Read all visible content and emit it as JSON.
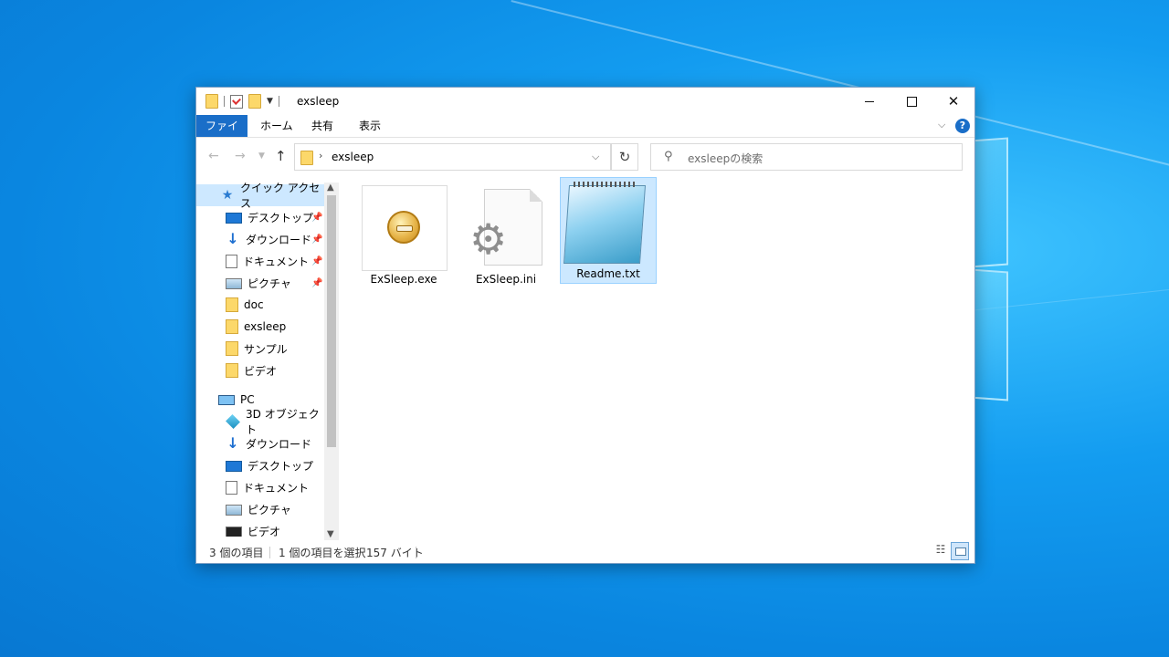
{
  "window": {
    "title": "exsleep"
  },
  "ribbon": {
    "tabs": [
      "ファイル",
      "ホーム",
      "共有",
      "表示"
    ]
  },
  "address": {
    "path": "exsleep",
    "search_placeholder": "exsleepの検索"
  },
  "nav_pane": {
    "quick_access": "クイック アクセス",
    "quick_items": [
      {
        "label": "デスクトップ",
        "icon": "desktop-icon",
        "pinned": true
      },
      {
        "label": "ダウンロード",
        "icon": "download-icon",
        "pinned": true
      },
      {
        "label": "ドキュメント",
        "icon": "document-icon",
        "pinned": true
      },
      {
        "label": "ピクチャ",
        "icon": "pictures-icon",
        "pinned": true
      },
      {
        "label": "doc",
        "icon": "folder-icon",
        "pinned": false
      },
      {
        "label": "exsleep",
        "icon": "folder-icon",
        "pinned": false
      },
      {
        "label": "サンプル",
        "icon": "folder-icon",
        "pinned": false
      },
      {
        "label": "ビデオ",
        "icon": "folder-icon",
        "pinned": false
      }
    ],
    "pc": "PC",
    "pc_items": [
      {
        "label": "3D オブジェクト",
        "icon": "3d-objects-icon"
      },
      {
        "label": "ダウンロード",
        "icon": "download-icon"
      },
      {
        "label": "デスクトップ",
        "icon": "desktop-icon"
      },
      {
        "label": "ドキュメント",
        "icon": "document-icon"
      },
      {
        "label": "ピクチャ",
        "icon": "pictures-icon"
      },
      {
        "label": "ビデオ",
        "icon": "video-icon"
      }
    ]
  },
  "files": [
    {
      "name": "ExSleep.exe",
      "icon": "exe-icon",
      "selected": false
    },
    {
      "name": "ExSleep.ini",
      "icon": "settings-file-icon",
      "selected": false
    },
    {
      "name": "Readme.txt",
      "icon": "notepad-icon",
      "selected": true
    }
  ],
  "status": {
    "item_count": "3 個の項目",
    "selection": "1 個の項目を選択",
    "size": "157 バイト"
  },
  "colors": {
    "accent": "#1a6ec8",
    "selection": "#cce8ff",
    "desktop": "#0a86e0"
  }
}
